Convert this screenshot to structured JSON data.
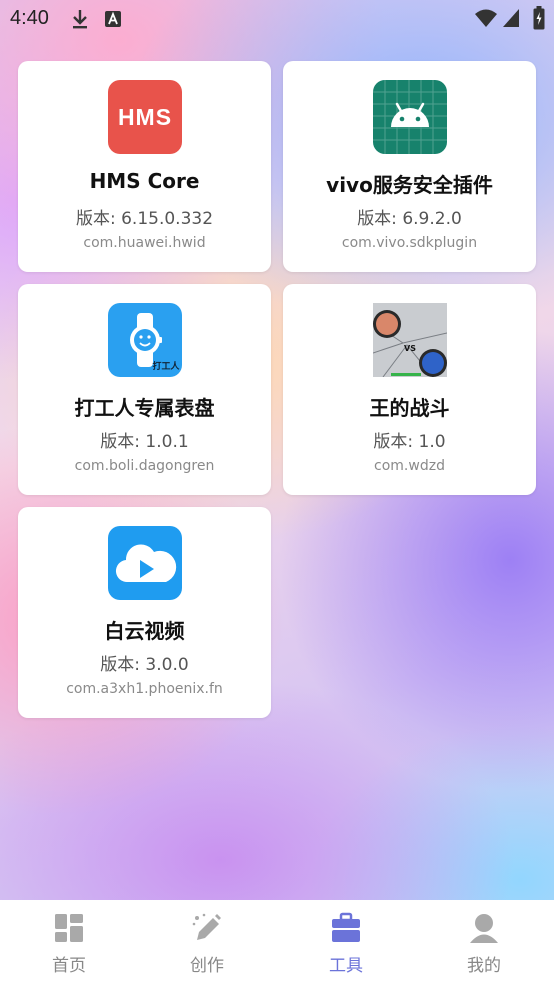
{
  "status_bar": {
    "time": "4:40"
  },
  "apps": [
    {
      "name": "HMS Core",
      "version": "版本: 6.15.0.332",
      "package": "com.huawei.hwid",
      "icon_text": "HMS",
      "icon": "hms-icon"
    },
    {
      "name": "vivo服务安全插件",
      "version": "版本: 6.9.2.0",
      "package": "com.vivo.sdkplugin",
      "icon": "android-icon"
    },
    {
      "name": "打工人专属表盘",
      "version": "版本: 1.0.1",
      "package": "com.boli.dagongren",
      "icon_text": "打工人",
      "icon": "watch-icon"
    },
    {
      "name": "王的战斗",
      "version": "版本: 1.0",
      "package": "com.wdzd",
      "icon_text": "VS",
      "icon": "battle-game-icon"
    },
    {
      "name": "白云视频",
      "version": "版本: 3.0.0",
      "package": "com.a3xh1.phoenix.fn",
      "icon": "cloud-play-icon"
    }
  ],
  "nav": [
    {
      "label": "首页",
      "icon": "home-grid-icon"
    },
    {
      "label": "创作",
      "icon": "pen-icon"
    },
    {
      "label": "工具",
      "icon": "toolbox-icon",
      "active": true
    },
    {
      "label": "我的",
      "icon": "profile-icon"
    }
  ],
  "colors": {
    "accent": "#6b73d9",
    "hms_red": "#e8534b",
    "android_green": "#17826c",
    "watch_blue": "#2aa0f0",
    "video_blue": "#1f9cf0"
  }
}
